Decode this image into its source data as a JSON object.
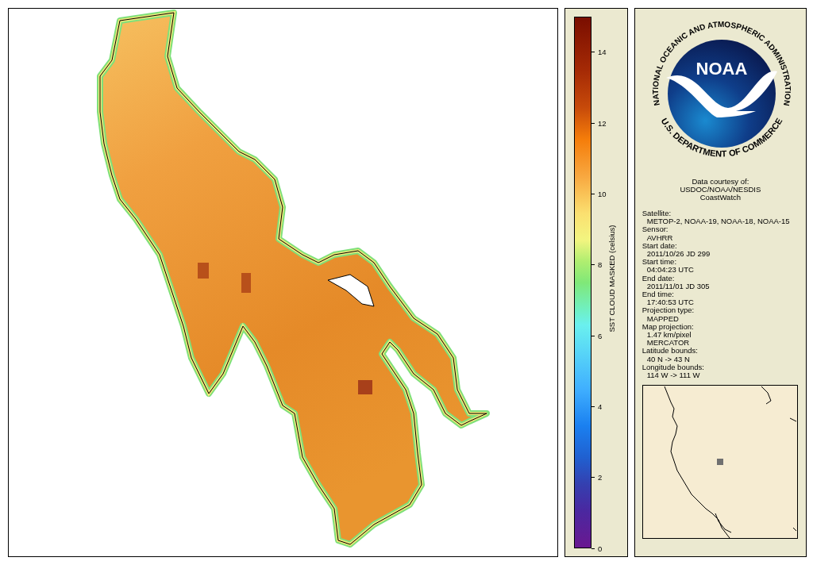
{
  "colorbar": {
    "title": "SST CLOUD MASKED (celsius)",
    "ticks": [
      "14",
      "12",
      "10",
      "8",
      "6",
      "4",
      "2",
      "0"
    ]
  },
  "logo": {
    "center_text": "NOAA",
    "top_text": "NATIONAL OCEANIC AND ATMOSPHERIC ADMINISTRATION",
    "bottom_text": "U.S. DEPARTMENT OF COMMERCE"
  },
  "credit": [
    "Data courtesy of:",
    "USDOC/NOAA/NESDIS",
    "CoastWatch"
  ],
  "metadata": [
    {
      "label": "Satellite:",
      "values": [
        "METOP-2, NOAA-19, NOAA-18, NOAA-15"
      ]
    },
    {
      "label": "Sensor:",
      "values": [
        "AVHRR"
      ]
    },
    {
      "label": "Start date:",
      "values": [
        "2011/10/26 JD 299"
      ]
    },
    {
      "label": "Start time:",
      "values": [
        "04:04:23 UTC"
      ]
    },
    {
      "label": "End date:",
      "values": [
        "2011/11/01 JD 305"
      ]
    },
    {
      "label": "End time:",
      "values": [
        "17:40:53 UTC"
      ]
    },
    {
      "label": "Projection type:",
      "values": [
        "MAPPED"
      ]
    },
    {
      "label": "Map projection:",
      "values": [
        "1.47 km/pixel",
        "MERCATOR"
      ]
    },
    {
      "label": "Latitude bounds:",
      "values": [
        "40 N -> 43 N"
      ]
    },
    {
      "label": "Longitude bounds:",
      "values": [
        "114 W -> 111 W"
      ]
    }
  ]
}
